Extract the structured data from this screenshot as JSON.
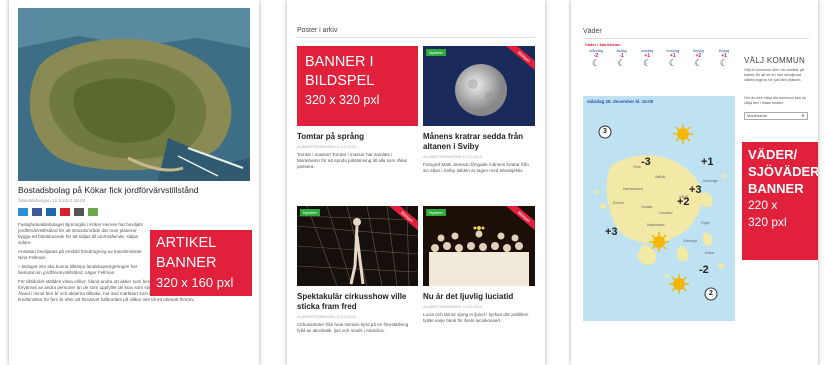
{
  "panel1": {
    "headline": "Bostadsbolag på Kökar fick jordförvärvstillstånd",
    "byline": "Ålandstidningen 12.3.2013 15:02",
    "share_icons": [
      {
        "name": "twitter-icon",
        "color": "#2b8fd6"
      },
      {
        "name": "facebook-icon",
        "color": "#3b5998"
      },
      {
        "name": "linkedin-icon",
        "color": "#1f6aa5"
      },
      {
        "name": "youtube-icon",
        "color": "#d6202b"
      },
      {
        "name": "print-icon",
        "color": "#555555"
      },
      {
        "name": "email-icon",
        "color": "#6aa84f"
      }
    ],
    "body_paragraphs": [
      "Fastighetsaktiebolaget Björnsgås i Kökar Hemse har beviljats jordförvärvstillstånd för att strandområde där man planerar bygga ett fritidsboende för att säljas till utomstående, säljas vidare.",
      "Ansökan beviljades på enskild föredragning av kansliminister Nina Fellman.",
      "– Bolaget inte ska kunna tillämpa landskapsregeringen har beslutat om jordförvärvstillstånd, säger Fellman.",
      "För tillsåndet ställdes vissa villkor, bland andra att aktier som berättigar till besittning av markområde inte får förvärvas av andra personer än de som uppfyller de krav som ställs på personer har hembygdsrätt, har bott på Åland i minst fem år och aktierna tillbaka, har änd märkbart som berättigar eller som är efterlevande make samt kreditinstitut för fem år efter att förvärvet fullbordats på villkor inte till ett obesatt förvärv."
    ],
    "banner": {
      "line1": "ARTIKEL",
      "line2": "BANNER",
      "size": "320 x 160 pxl"
    }
  },
  "panel2": {
    "section_title": "Poster i arkiv",
    "banner": {
      "line1": "BANNER I",
      "line2": "BILDSPEL",
      "size": "320 x 320 pxl"
    },
    "articles": [
      {
        "title": "Tomtar på språng",
        "meta": "ALANDSTIDNINGEN 12.12.2013",
        "excerpt": "Tomtar i massor! Tomtar i massor har samlats i Mariehamn för att sprida julstämning till alla som råkar passera."
      },
      {
        "title": "Månens kratrar sedda från altanen i Sviby",
        "meta": "ALANDSTIDNINGEN 11.12.2013",
        "excerpt": "Fotograf Mats Jansson fångade månens kratrar från sin altan i Sviby. Bilden är tagen med teleobjektiv.",
        "tag": "Nyheter",
        "ribbon": "Bildspel"
      },
      {
        "title": "Spektakulär cirkusshow ville sticka fram fred",
        "meta": "ALANDSTIDNINGEN 10.12.2013",
        "excerpt": "Cirkusartister från hela Norden bjöd på en föreställning fylld av akrobatik, ljus och musik i Alandica.",
        "tag": "Nyheter",
        "ribbon": "Bildspel"
      },
      {
        "title": "Nu är det ljuvlig luciatid",
        "meta": "ALANDSTIDNINGEN 13.12.2013",
        "excerpt": "Lucia och tärnor sjöng in ljuset i kyrkan där publiken fyllde varje bänk för årets luciakonsert.",
        "tag": "Nyheter",
        "ribbon": "Bildspel"
      }
    ]
  },
  "panel3": {
    "section_title": "Väder",
    "forecast_label": "Väder i Mariehamn",
    "days": [
      {
        "day": "måndag",
        "temp": "-2",
        "icon": "moon-icon"
      },
      {
        "day": "tisdag",
        "temp": "-1",
        "icon": "moon-icon"
      },
      {
        "day": "onsdag",
        "temp": "+1",
        "icon": "moon-icon"
      },
      {
        "day": "torsdag",
        "temp": "+1",
        "icon": "moon-icon"
      },
      {
        "day": "fredag",
        "temp": "+2",
        "icon": "moon-icon"
      },
      {
        "day": "lördag",
        "temp": "+1",
        "icon": "moon-icon"
      }
    ],
    "map_title": "måndag 28. december kl. 15:00",
    "map_temps": [
      "+1",
      "-3",
      "+3",
      "+2",
      "+3",
      "-2"
    ],
    "map_winds": [
      "3",
      "2"
    ],
    "choose_heading": "VÄLJ KOMMUN",
    "choose_text": "Välj en kommun eller ett område på kartan för att se en mer detaljerad väderprognos för just den platsen.",
    "choose_text2": "Om du inte hittar din kommun kan du välja den i listan nedan.",
    "select_value": "Mariehamn",
    "banner": {
      "line1": "VÄDER/",
      "line2": "SJÖVÄDER",
      "line3": "BANNER",
      "size1": "220 x",
      "size2": "320 pxl"
    }
  }
}
